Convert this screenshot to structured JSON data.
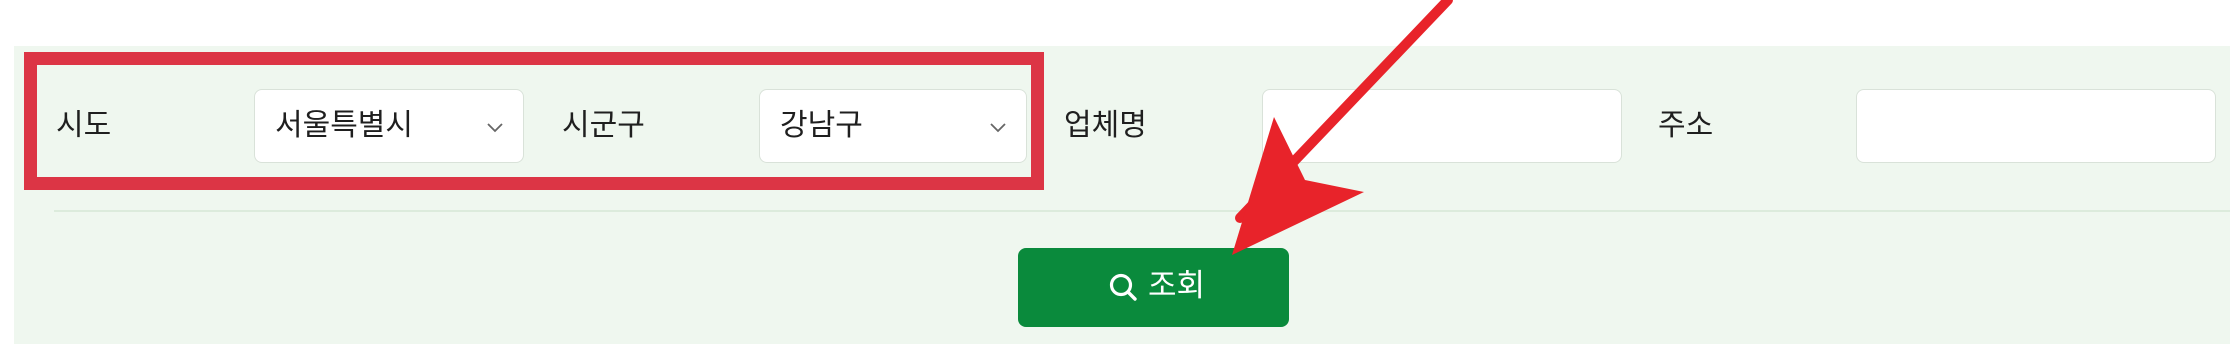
{
  "filters": {
    "sido": {
      "label": "시도",
      "value": "서울특별시"
    },
    "sigungu": {
      "label": "시군구",
      "value": "강남구"
    },
    "company_name": {
      "label": "업체명",
      "value": ""
    },
    "address": {
      "label": "주소",
      "value": ""
    }
  },
  "search_button": {
    "label": "조회",
    "icon": "search-icon"
  },
  "annotations": {
    "highlight_color": "#dc3545",
    "arrow_color": "#e8232a"
  },
  "colors": {
    "panel_bg": "#eff7ef",
    "button_bg": "#0a8a3c"
  }
}
